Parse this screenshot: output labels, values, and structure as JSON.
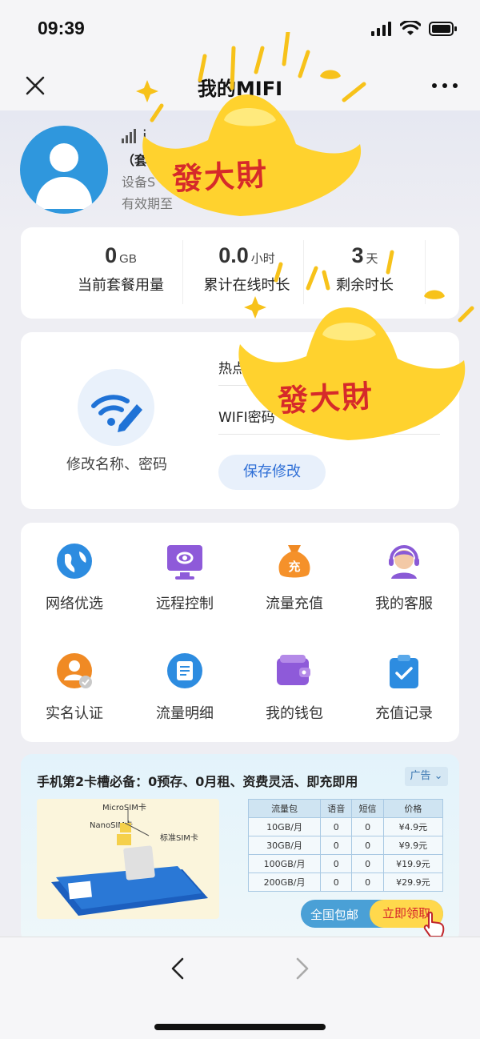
{
  "status_bar": {
    "time": "09:39"
  },
  "nav": {
    "title": "我的MIFI"
  },
  "profile": {
    "name": "i",
    "plan": "（套",
    "device": "设备S",
    "expire": "有效期至"
  },
  "stats": [
    {
      "value": "0",
      "unit": "GB",
      "label": "当前套餐用量"
    },
    {
      "value": "0.0",
      "unit": "小时",
      "label": "累计在线时长"
    },
    {
      "value": "3",
      "unit": "天",
      "label": "剩余时长"
    }
  ],
  "wifi_edit": {
    "label": "修改名称、密码",
    "hotspot_label": "热点名",
    "password_label": "WIFI密码",
    "save_label": "保存修改"
  },
  "grid": [
    {
      "label": "网络优选",
      "icon": "globe-icon"
    },
    {
      "label": "远程控制",
      "icon": "remote-control-icon"
    },
    {
      "label": "流量充值",
      "icon": "recharge-bag-icon"
    },
    {
      "label": "我的客服",
      "icon": "customer-service-icon"
    },
    {
      "label": "实名认证",
      "icon": "id-verify-icon"
    },
    {
      "label": "流量明细",
      "icon": "usage-detail-icon"
    },
    {
      "label": "我的钱包",
      "icon": "wallet-icon"
    },
    {
      "label": "充值记录",
      "icon": "recharge-record-icon"
    }
  ],
  "ad": {
    "title": "手机第2卡槽必备：0预存、0月租、资费灵活、即充即用",
    "tag": "广告",
    "sim_labels": {
      "micro": "MicroSIM卡",
      "nano": "NanoSIM卡",
      "standard": "标准SIM卡"
    },
    "table_headers": [
      "流量包",
      "语音",
      "短信",
      "价格"
    ],
    "table_rows": [
      [
        "10GB/月",
        "0",
        "0",
        "¥4.9元"
      ],
      [
        "30GB/月",
        "0",
        "0",
        "¥9.9元"
      ],
      [
        "100GB/月",
        "0",
        "0",
        "¥19.9元"
      ],
      [
        "200GB/月",
        "0",
        "0",
        "¥29.9元"
      ]
    ],
    "pill_left": "全国包邮",
    "pill_right": "立即领取"
  },
  "stickers": [
    {
      "text": "發大財"
    },
    {
      "text": "發大財"
    }
  ],
  "colors": {
    "accent_blue": "#2f97dd",
    "save_text": "#2f6fd6",
    "sticker_gold": "#ffc928",
    "sticker_text": "#d62a2a"
  }
}
